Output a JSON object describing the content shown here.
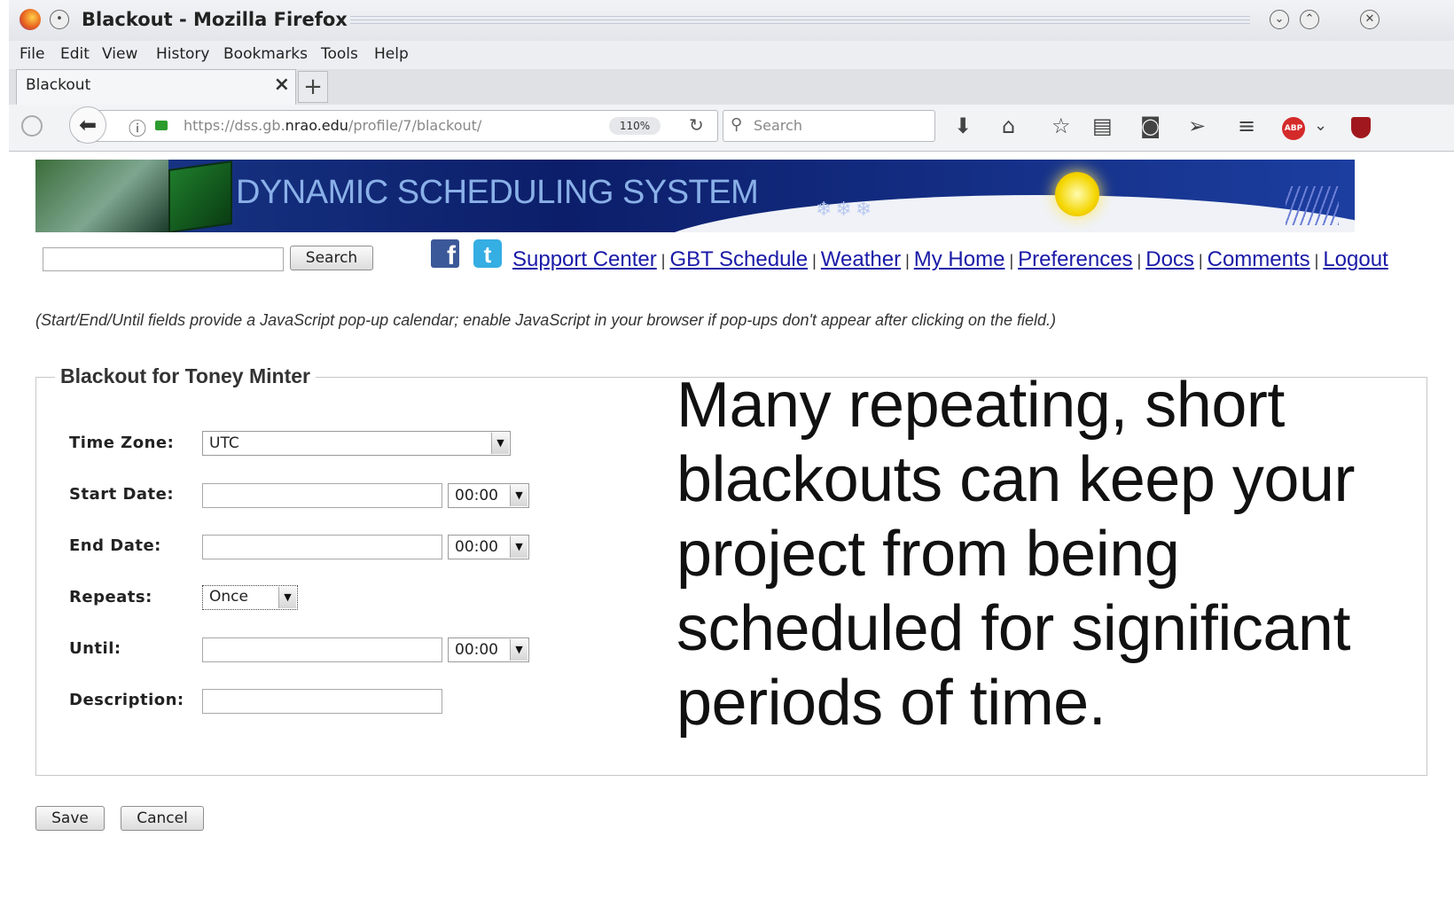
{
  "window": {
    "title": "Blackout - Mozilla Firefox"
  },
  "menu": [
    "File",
    "Edit",
    "View",
    "History",
    "Bookmarks",
    "Tools",
    "Help"
  ],
  "tab": {
    "title": "Blackout",
    "close": "×",
    "new_tab": "+"
  },
  "nav": {
    "url_scheme_host_pre": "https://dss.gb.",
    "url_host_bold": "nrao.edu",
    "url_path": "/profile/7/blackout/",
    "zoom": "110%",
    "search_placeholder": "Search"
  },
  "banner": {
    "title": "DYNAMIC SCHEDULING SYSTEM"
  },
  "site": {
    "search_button": "Search",
    "social": {
      "facebook": "f",
      "twitter": "t"
    },
    "links": [
      "Support Center",
      "GBT Schedule",
      "Weather",
      "My Home",
      "Preferences",
      "Docs",
      "Comments",
      "Logout"
    ],
    "separator": "|",
    "note": "(Start/End/Until fields provide a JavaScript pop-up calendar; enable JavaScript in your browser if pop-ups don't appear after clicking on the field.)"
  },
  "form": {
    "legend": "Blackout for Toney Minter",
    "time_zone_label": "Time Zone:",
    "time_zone_value": "UTC",
    "start_label": "Start Date:",
    "start_time": "00:00",
    "end_label": "End Date:",
    "end_time": "00:00",
    "repeats_label": "Repeats:",
    "repeats_value": "Once",
    "until_label": "Until:",
    "until_time": "00:00",
    "description_label": "Description:",
    "save": "Save",
    "cancel": "Cancel"
  },
  "overlay_text": "Many repeating, short blackouts can keep your project from being scheduled for significant periods of time.",
  "colors": {
    "link": "#1a1aa8",
    "banner": "#0c1e6a"
  }
}
